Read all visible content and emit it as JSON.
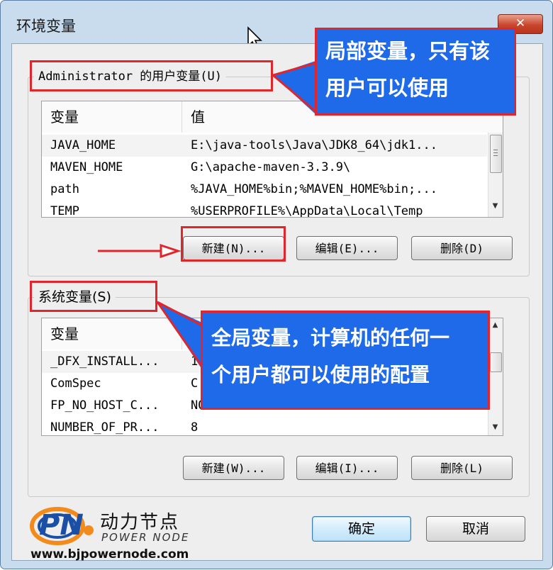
{
  "window": {
    "title": "环境变量",
    "close_label": "✕"
  },
  "user_group": {
    "legend": "Administrator 的用户变量(U)",
    "columns": [
      "变量",
      "值"
    ],
    "rows": [
      {
        "name": "JAVA_HOME",
        "value": "E:\\java-tools\\Java\\JDK8_64\\jdk1..."
      },
      {
        "name": "MAVEN_HOME",
        "value": "G:\\apache-maven-3.3.9\\"
      },
      {
        "name": "path",
        "value": "%JAVA_HOME%bin;%MAVEN_HOME%bin;..."
      },
      {
        "name": "TEMP",
        "value": "%USERPROFILE%\\AppData\\Local\\Temp"
      }
    ],
    "buttons": {
      "new": "新建(N)...",
      "edit": "编辑(E)...",
      "delete": "删除(D)"
    }
  },
  "system_group": {
    "legend": "系统变量(S)",
    "columns": [
      "变量",
      ""
    ],
    "rows": [
      {
        "name": "_DFX_INSTALL...",
        "value": "1"
      },
      {
        "name": "ComSpec",
        "value": "C"
      },
      {
        "name": "FP_NO_HOST_C...",
        "value": "NO"
      },
      {
        "name": "NUMBER_OF_PR...",
        "value": "8"
      }
    ],
    "buttons": {
      "new": "新建(W)...",
      "edit": "编辑(I)...",
      "delete": "删除(L)"
    }
  },
  "dialog_buttons": {
    "ok": "确定",
    "cancel": "取消"
  },
  "annotations": {
    "user_callout": [
      "局部变量，只有该",
      "用户可以使用"
    ],
    "system_callout": [
      "全局变量，计算机的任何一",
      "个用户都可以使用的配置"
    ]
  },
  "watermark": {
    "brand_cn": "动力节点",
    "brand_en": "POWER NODE",
    "url": "www.bjpowernode.com",
    "logo_letters": "PN"
  },
  "colors": {
    "annotation_red": "#e0262c",
    "callout_blue": "#1e6ae8",
    "accent_ok": "#3c7fb1"
  }
}
